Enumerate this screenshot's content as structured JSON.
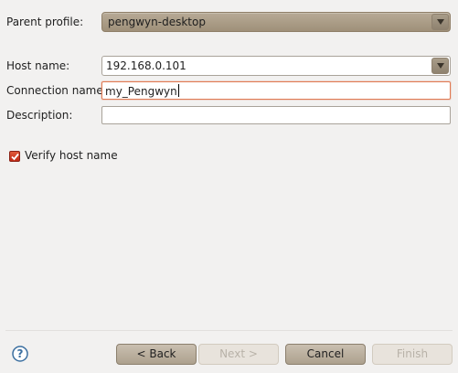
{
  "form": {
    "parent_profile": {
      "label": "Parent profile:",
      "value": "pengwyn-desktop"
    },
    "host_name": {
      "label": "Host name:",
      "value": "192.168.0.101"
    },
    "connection_name": {
      "label": "Connection name:",
      "value": "my_Pengwyn"
    },
    "description": {
      "label": "Description:",
      "value": ""
    },
    "verify_host_name": {
      "label": "Verify host name",
      "checked": true
    }
  },
  "buttons": {
    "back": "< Back",
    "next": "Next >",
    "cancel": "Cancel",
    "finish": "Finish"
  },
  "icons": {
    "help": "help-icon",
    "dropdown": "chevron-down-icon",
    "check": "check-icon"
  },
  "colors": {
    "background": "#f2f1f0",
    "combo_active": "#a89a84",
    "focus_border": "#e07a53",
    "checkbox": "#c9321c",
    "help_icon": "#3b6fa0"
  }
}
